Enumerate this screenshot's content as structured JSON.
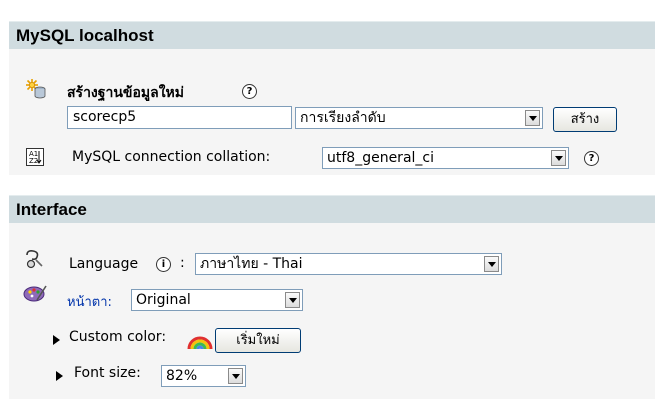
{
  "mysql_section": {
    "title": "MySQL localhost",
    "create_db": {
      "label": "สร้างฐานข้อมูลใหม่",
      "help": "?",
      "db_name_value": "scorecp5",
      "collation_select": "การเรียงลำดับ",
      "create_button": "สร้าง"
    },
    "connection_collation": {
      "label": "MySQL connection collation:",
      "value": "utf8_general_ci",
      "help": "?"
    }
  },
  "interface_section": {
    "title": "Interface",
    "language": {
      "label": "Language",
      "info": "i",
      "separator": ":",
      "value": "ภาษาไทย - Thai"
    },
    "theme": {
      "label": "หน้าตา:",
      "value": "Original"
    },
    "custom_color": {
      "label": "Custom color:",
      "reset_button": "เริ่มใหม่"
    },
    "font_size": {
      "label": "Font size:",
      "value": "82%"
    }
  },
  "colors": {
    "header_bg": "#d0dce0",
    "panel_bg": "#f5f5f5",
    "link_blue": "#0033aa"
  }
}
